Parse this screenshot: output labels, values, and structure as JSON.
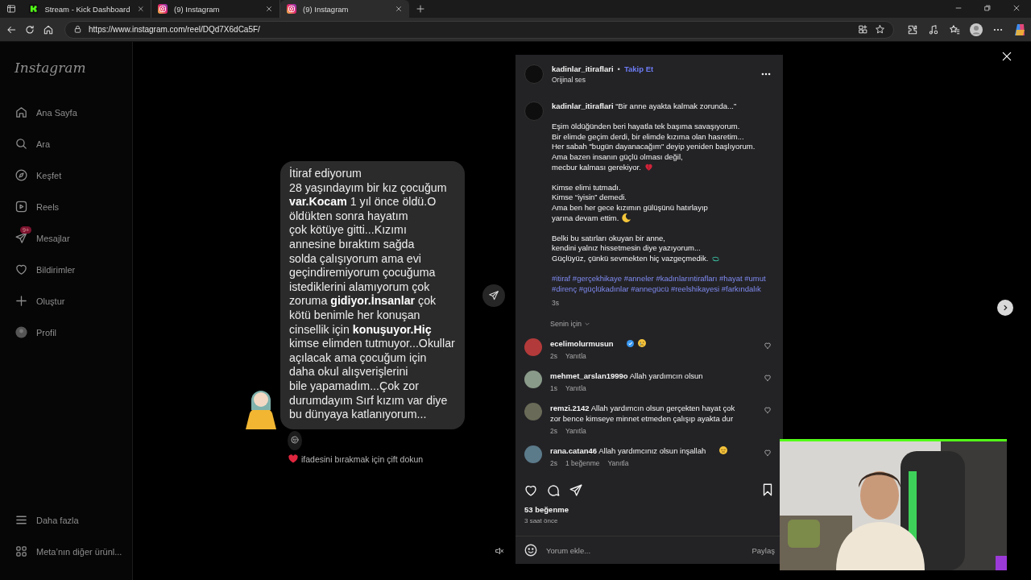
{
  "browser": {
    "tabs": [
      {
        "title": "Stream - Kick Dashboard",
        "kind": "kick",
        "selected": false
      },
      {
        "title": "(9) Instagram",
        "kind": "instagram",
        "selected": false
      },
      {
        "title": "(9) Instagram",
        "kind": "instagram",
        "selected": true
      }
    ],
    "url": "https://www.instagram.com/reel/DQd7X6dCa5F/"
  },
  "sidebar": {
    "logo": "Instagram",
    "items": [
      {
        "label": "Ana Sayfa"
      },
      {
        "label": "Ara"
      },
      {
        "label": "Keşfet"
      },
      {
        "label": "Reels"
      },
      {
        "label": "Mesajlar",
        "badge": "9+"
      },
      {
        "label": "Bildirimler"
      },
      {
        "label": "Oluştur"
      },
      {
        "label": "Profil"
      }
    ],
    "footer": [
      {
        "label": "Daha fazla"
      },
      {
        "label": "Meta’nın diğer ürünl..."
      }
    ]
  },
  "reel": {
    "message": "İtiraf ediyorum\n28 yaşındayım bir kız çocuğum\n**var.Kocam** 1 yıl önce öldü.O\nöldükten sonra hayatım\nçok kötüye gitti...Kızımı\nannesine bıraktım sağda\nsolda çalışıyorum ama evi\ngeçindiremiyorum çocuğuma\nistediklerini alamıyorum çok\nzoruma **gidiyor.İnsanlar** çok\nkötü benimle her konuşan\ncinsellik için **konuşuyor.Hiç**\nkimse elimden tutmuyor...Okullar\naçılacak ama çocuğum için\ndaha okul alışverişlerini\nbile yapamadım...Çok zor\ndurumdayım Sırf kızım var diye\nbu dünyaya katlanıyorum...",
    "reaction_hint": "ifadesini bırakmak için çift dokun",
    "muted": true
  },
  "post": {
    "author": "kadinlar_itiraflari",
    "separator": "•",
    "follow": "Takip Et",
    "audio": "Orijinal ses",
    "caption": {
      "author": "kadinlar_itiraflari",
      "title": "“Bir anne ayakta kalmak zorunda...”",
      "paragraphs": [
        {
          "kind": "heart",
          "lines": [
            "Eşim öldüğünden beri hayatla tek başıma savaşıyorum.",
            "Bir elimde geçim derdi, bir elimde kızıma olan hasretim...",
            "Her sabah \"bugün dayanacağım\" deyip yeniden başlıyorum.",
            "Ama bazen insanın güçlü olması değil,",
            "mecbur kalması gerekiyor."
          ]
        },
        {
          "kind": "moon",
          "lines": [
            "Kimse elimi tutmadı.",
            "Kimse “iyisin” demedi.",
            "Ama ben her gece kızımın gülüşünü hatırlayıp",
            "yarına devam ettim."
          ]
        },
        {
          "kind": "loop",
          "lines": [
            "Belki bu satırları okuyan bir anne,",
            "kendini yalnız hissetmesin diye yazıyorum...",
            "Güçlüyüz, çünkü sevmekten hiç vazgeçmedik."
          ]
        }
      ],
      "hashtags": "#itiraf #gerçekhikaye #anneler #kadınlarıntirafları #hayat #umut\n#direnç #güçlükadınlar #annegücü #reelshikayesi #farkındalık",
      "time": "3s"
    },
    "sort": "Senin için",
    "comments": [
      {
        "user": "ecelimolurmusun",
        "verified": true,
        "kind": "sad",
        "time": "2s",
        "reply": "Yanıtla"
      },
      {
        "user": "mehmet_arslan1999o",
        "text": "Allah yardımcın olsun",
        "verified": false,
        "kind": "plain",
        "time": "1s",
        "reply": "Yanıtla"
      },
      {
        "user": "remzi.2142",
        "text": "Allah yardımcın olsun gerçekten hayat çok zor bence kimseye minnet etmeden çalışıp ayakta dur",
        "verified": false,
        "kind": "plain",
        "time": "2s",
        "reply": "Yanıtla"
      },
      {
        "user": "rana.catan46",
        "text": "Allah yardımcınız olsun inşallah",
        "verified": false,
        "kind": "pensive",
        "time": "2s",
        "likes": "1 beğenme",
        "reply": "Yanıtla"
      }
    ],
    "likes": "53 beğenme",
    "posted": "3 saat önce",
    "comment_placeholder": "Yorum ekle...",
    "share": "Paylaş"
  }
}
